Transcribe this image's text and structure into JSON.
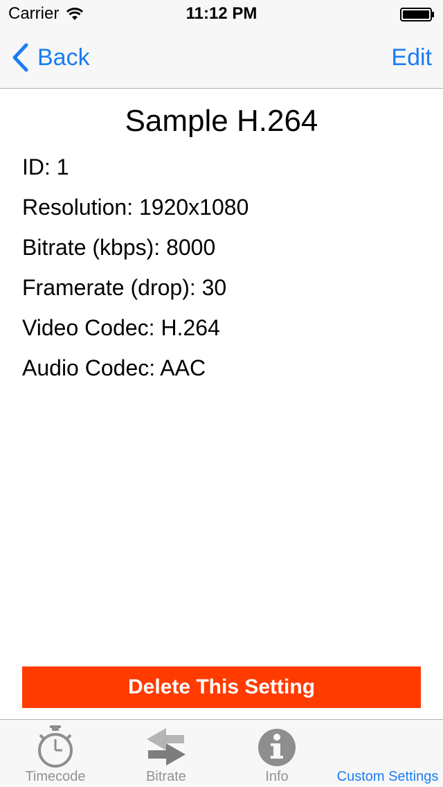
{
  "status_bar": {
    "carrier": "Carrier",
    "time": "11:12 PM"
  },
  "nav": {
    "back_label": "Back",
    "edit_label": "Edit"
  },
  "detail": {
    "title": "Sample H.264",
    "fields": [
      "ID: 1",
      "Resolution: 1920x1080",
      "Bitrate (kbps): 8000",
      "Framerate (drop): 30",
      "Video Codec: H.264",
      "Audio Codec: AAC"
    ]
  },
  "actions": {
    "delete_label": "Delete This Setting"
  },
  "tab_bar": {
    "tabs": [
      {
        "label": "Timecode",
        "icon": "stopwatch-icon",
        "active": false
      },
      {
        "label": "Bitrate",
        "icon": "arrows-icon",
        "active": false
      },
      {
        "label": "Info",
        "icon": "info-icon",
        "active": false
      },
      {
        "label": "Custom Settings",
        "icon": "settings-icon",
        "active": true
      }
    ]
  },
  "colors": {
    "accent": "#1a7cf4",
    "delete": "#ff3b00",
    "bar_background": "#f7f7f7",
    "tab_inactive": "#929292"
  }
}
